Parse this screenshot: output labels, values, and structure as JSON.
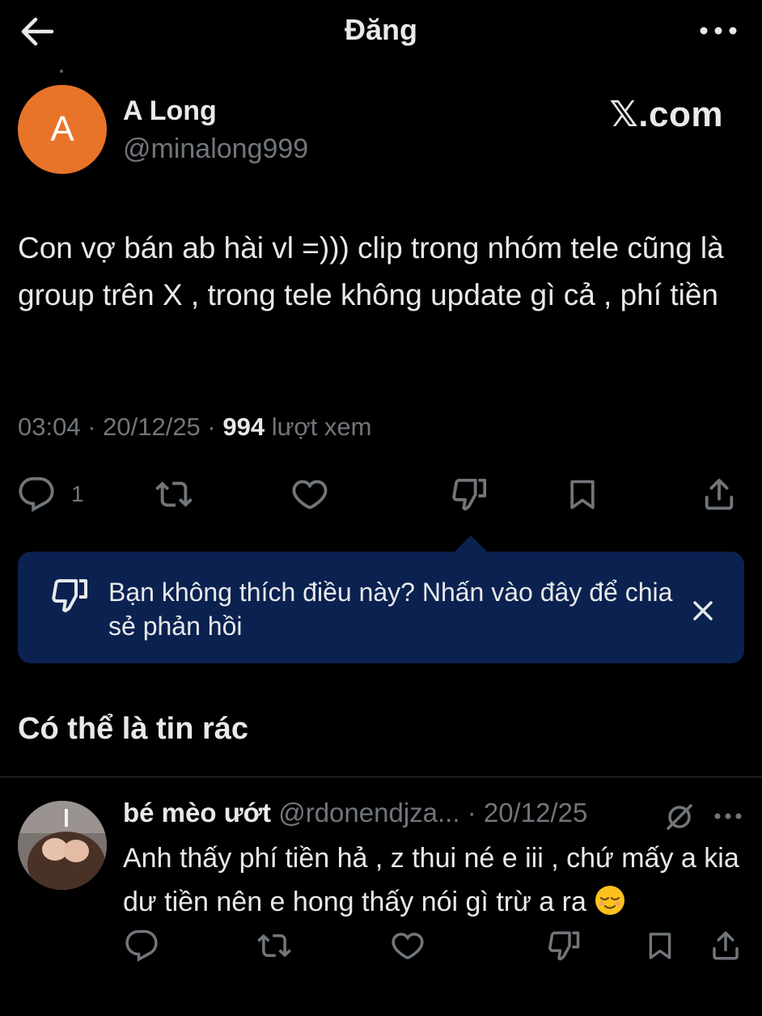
{
  "header": {
    "title": "Đăng"
  },
  "post": {
    "avatar_letter": "A",
    "author_name": "A Long",
    "author_handle": "@minalong999",
    "source_label": "𝕏.com",
    "text": "Con vợ bán ab hài vl =))) clip trong nhóm tele cũng là group trên X , trong tele không update gì cả , phí tiền",
    "time": "03:04 · 20/12/25 ·",
    "views_count": "994",
    "views_label": "lượt xem",
    "reply_count": "1"
  },
  "feedback": {
    "text": "Bạn không thích điều này? Nhấn vào đây để chia sẻ phản hồi"
  },
  "section": {
    "title": "Có thể là tin rác"
  },
  "reply": {
    "name": "bé mèo ướt",
    "handle": "@rdonendjza...",
    "date": "· 20/12/25",
    "text": "Anh thấy phí tiền hả , z thui né e iii , chứ mấy a kia dư tiền nên e hong thấy nói gì trừ a ra"
  },
  "icons": [
    "arrow-left-icon",
    "more-icon",
    "reply-icon",
    "repost-icon",
    "like-icon",
    "dislike-icon",
    "bookmark-icon",
    "share-icon",
    "close-icon",
    "grok-icon",
    "relieved-face-emoji"
  ],
  "colors": {
    "background": "#000000",
    "text": "#e7e9ea",
    "secondary": "#71767b",
    "feedback_card": "#0b2150",
    "avatar": "#e8742a"
  }
}
